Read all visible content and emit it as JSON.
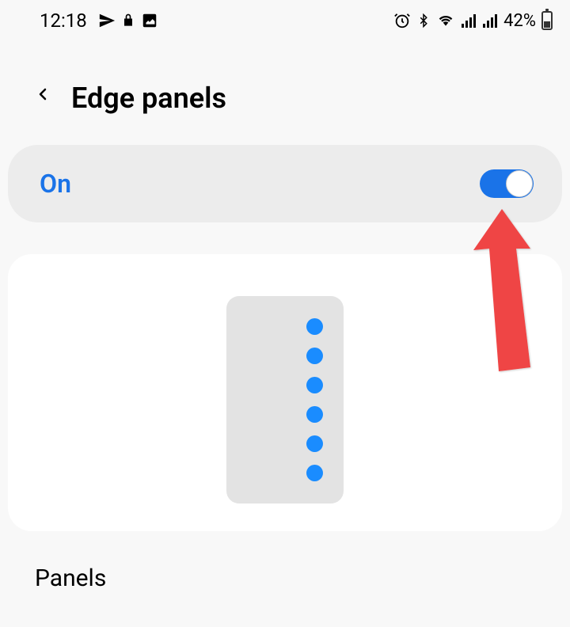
{
  "status_bar": {
    "time": "12:18",
    "battery_percent": "42%"
  },
  "header": {
    "title": "Edge panels"
  },
  "toggle": {
    "label": "On",
    "state": true
  },
  "section": {
    "panels_label": "Panels"
  }
}
